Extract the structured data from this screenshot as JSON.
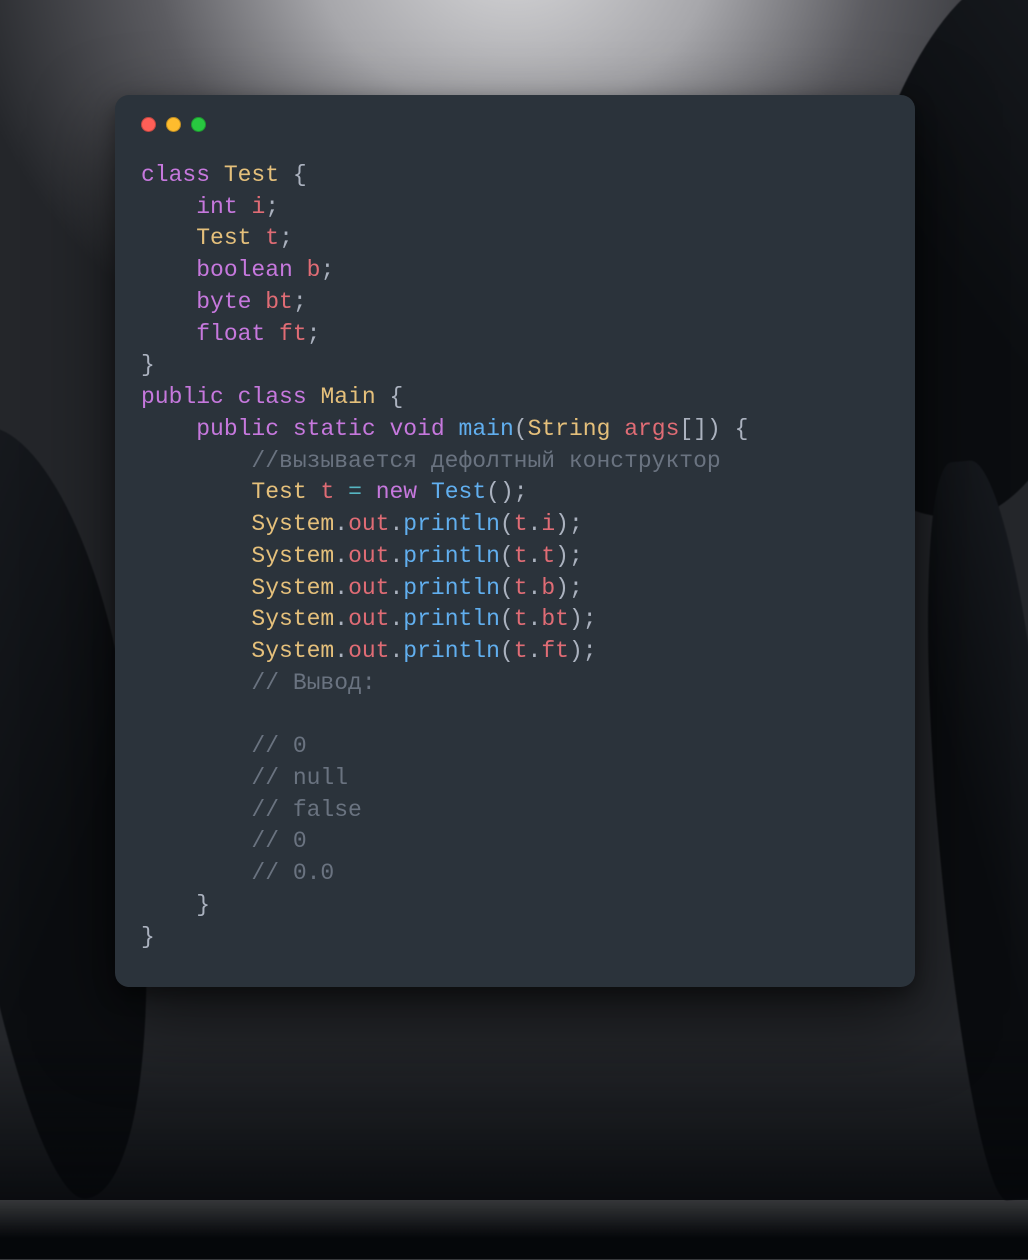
{
  "window": {
    "traffic_colors": {
      "close": "#ff5f57",
      "minimize": "#febc2e",
      "zoom": "#28c840"
    }
  },
  "code": {
    "language": "java",
    "lines": [
      {
        "indent": 0,
        "tokens": [
          [
            "kw",
            "class"
          ],
          [
            "sp",
            " "
          ],
          [
            "class",
            "Test"
          ],
          [
            "sp",
            " "
          ],
          [
            "punct",
            "{"
          ]
        ]
      },
      {
        "indent": 1,
        "tokens": [
          [
            "type",
            "int"
          ],
          [
            "sp",
            " "
          ],
          [
            "ident",
            "i"
          ],
          [
            "punct",
            ";"
          ]
        ]
      },
      {
        "indent": 1,
        "tokens": [
          [
            "class",
            "Test"
          ],
          [
            "sp",
            " "
          ],
          [
            "ident",
            "t"
          ],
          [
            "punct",
            ";"
          ]
        ]
      },
      {
        "indent": 1,
        "tokens": [
          [
            "type",
            "boolean"
          ],
          [
            "sp",
            " "
          ],
          [
            "ident",
            "b"
          ],
          [
            "punct",
            ";"
          ]
        ]
      },
      {
        "indent": 1,
        "tokens": [
          [
            "type",
            "byte"
          ],
          [
            "sp",
            " "
          ],
          [
            "ident",
            "bt"
          ],
          [
            "punct",
            ";"
          ]
        ]
      },
      {
        "indent": 1,
        "tokens": [
          [
            "type",
            "float"
          ],
          [
            "sp",
            " "
          ],
          [
            "ident",
            "ft"
          ],
          [
            "punct",
            ";"
          ]
        ]
      },
      {
        "indent": 0,
        "tokens": [
          [
            "punct",
            "}"
          ]
        ]
      },
      {
        "indent": 0,
        "tokens": [
          [
            "kw",
            "public"
          ],
          [
            "sp",
            " "
          ],
          [
            "kw",
            "class"
          ],
          [
            "sp",
            " "
          ],
          [
            "class",
            "Main"
          ],
          [
            "sp",
            " "
          ],
          [
            "punct",
            "{"
          ]
        ]
      },
      {
        "indent": 1,
        "tokens": [
          [
            "kw",
            "public"
          ],
          [
            "sp",
            " "
          ],
          [
            "kw",
            "static"
          ],
          [
            "sp",
            " "
          ],
          [
            "type",
            "void"
          ],
          [
            "sp",
            " "
          ],
          [
            "func",
            "main"
          ],
          [
            "punct",
            "("
          ],
          [
            "class",
            "String"
          ],
          [
            "sp",
            " "
          ],
          [
            "ident",
            "args"
          ],
          [
            "punct",
            "[])"
          ],
          [
            "sp",
            " "
          ],
          [
            "punct",
            "{"
          ]
        ]
      },
      {
        "indent": 2,
        "tokens": [
          [
            "comment",
            "//вызывается дефолтный конструктор"
          ]
        ]
      },
      {
        "indent": 2,
        "tokens": [
          [
            "class",
            "Test"
          ],
          [
            "sp",
            " "
          ],
          [
            "ident",
            "t"
          ],
          [
            "sp",
            " "
          ],
          [
            "op",
            "="
          ],
          [
            "sp",
            " "
          ],
          [
            "kw",
            "new"
          ],
          [
            "sp",
            " "
          ],
          [
            "func",
            "Test"
          ],
          [
            "punct",
            "();"
          ]
        ]
      },
      {
        "indent": 2,
        "tokens": [
          [
            "class",
            "System"
          ],
          [
            "punct",
            "."
          ],
          [
            "ident",
            "out"
          ],
          [
            "punct",
            "."
          ],
          [
            "func",
            "println"
          ],
          [
            "punct",
            "("
          ],
          [
            "ident",
            "t"
          ],
          [
            "punct",
            "."
          ],
          [
            "ident",
            "i"
          ],
          [
            "punct",
            ");"
          ]
        ]
      },
      {
        "indent": 2,
        "tokens": [
          [
            "class",
            "System"
          ],
          [
            "punct",
            "."
          ],
          [
            "ident",
            "out"
          ],
          [
            "punct",
            "."
          ],
          [
            "func",
            "println"
          ],
          [
            "punct",
            "("
          ],
          [
            "ident",
            "t"
          ],
          [
            "punct",
            "."
          ],
          [
            "ident",
            "t"
          ],
          [
            "punct",
            ");"
          ]
        ]
      },
      {
        "indent": 2,
        "tokens": [
          [
            "class",
            "System"
          ],
          [
            "punct",
            "."
          ],
          [
            "ident",
            "out"
          ],
          [
            "punct",
            "."
          ],
          [
            "func",
            "println"
          ],
          [
            "punct",
            "("
          ],
          [
            "ident",
            "t"
          ],
          [
            "punct",
            "."
          ],
          [
            "ident",
            "b"
          ],
          [
            "punct",
            ");"
          ]
        ]
      },
      {
        "indent": 2,
        "tokens": [
          [
            "class",
            "System"
          ],
          [
            "punct",
            "."
          ],
          [
            "ident",
            "out"
          ],
          [
            "punct",
            "."
          ],
          [
            "func",
            "println"
          ],
          [
            "punct",
            "("
          ],
          [
            "ident",
            "t"
          ],
          [
            "punct",
            "."
          ],
          [
            "ident",
            "bt"
          ],
          [
            "punct",
            ");"
          ]
        ]
      },
      {
        "indent": 2,
        "tokens": [
          [
            "class",
            "System"
          ],
          [
            "punct",
            "."
          ],
          [
            "ident",
            "out"
          ],
          [
            "punct",
            "."
          ],
          [
            "func",
            "println"
          ],
          [
            "punct",
            "("
          ],
          [
            "ident",
            "t"
          ],
          [
            "punct",
            "."
          ],
          [
            "ident",
            "ft"
          ],
          [
            "punct",
            ");"
          ]
        ]
      },
      {
        "indent": 2,
        "tokens": [
          [
            "comment",
            "// Вывод:"
          ]
        ]
      },
      {
        "indent": 2,
        "tokens": []
      },
      {
        "indent": 2,
        "tokens": [
          [
            "comment",
            "// 0"
          ]
        ]
      },
      {
        "indent": 2,
        "tokens": [
          [
            "comment",
            "// null"
          ]
        ]
      },
      {
        "indent": 2,
        "tokens": [
          [
            "comment",
            "// false"
          ]
        ]
      },
      {
        "indent": 2,
        "tokens": [
          [
            "comment",
            "// 0"
          ]
        ]
      },
      {
        "indent": 2,
        "tokens": [
          [
            "comment",
            "// 0.0"
          ]
        ]
      },
      {
        "indent": 1,
        "tokens": [
          [
            "punct",
            "}"
          ]
        ]
      },
      {
        "indent": 0,
        "tokens": [
          [
            "punct",
            "}"
          ]
        ]
      }
    ],
    "indent_unit": "    "
  }
}
